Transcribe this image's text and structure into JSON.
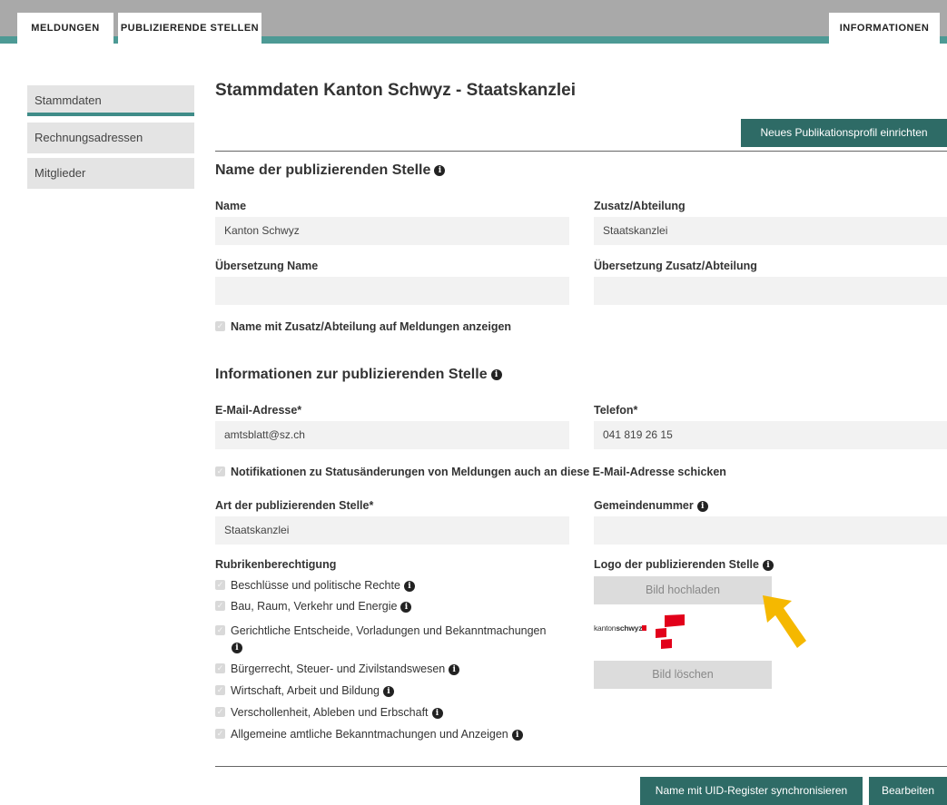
{
  "nav": {
    "tabs": [
      {
        "label": "MELDUNGEN"
      },
      {
        "label": "PUBLIZIERENDE STELLEN"
      },
      {
        "label": "INFORMATIONEN"
      }
    ]
  },
  "sidebar": {
    "items": [
      {
        "label": "Stammdaten"
      },
      {
        "label": "Rechnungsadressen"
      },
      {
        "label": "Mitglieder"
      }
    ]
  },
  "page": {
    "title": "Stammdaten Kanton Schwyz - Staatskanzlei",
    "new_profile_button": "Neues Publikationsprofil einrichten"
  },
  "section_name": {
    "heading": "Name der publizierenden Stelle",
    "name_label": "Name",
    "name_value": "Kanton Schwyz",
    "zusatz_label": "Zusatz/Abteilung",
    "zusatz_value": "Staatskanzlei",
    "translation_name_label": "Übersetzung Name",
    "translation_name_value": "",
    "translation_zusatz_label": "Übersetzung Zusatz/Abteilung",
    "translation_zusatz_value": "",
    "show_zusatz_checkbox": "Name mit Zusatz/Abteilung auf Meldungen anzeigen"
  },
  "section_info": {
    "heading": "Informationen zur publizierenden Stelle",
    "email_label": "E-Mail-Adresse*",
    "email_value": "amtsblatt@sz.ch",
    "phone_label": "Telefon*",
    "phone_value": "041 819 26 15",
    "notify_checkbox": "Notifikationen zu Statusänderungen von Meldungen auch an diese E-Mail-Adresse schicken",
    "type_label": "Art der publizierenden Stelle*",
    "type_value": "Staatskanzlei",
    "municipality_label": "Gemeindenummer",
    "municipality_value": ""
  },
  "rubriken": {
    "label": "Rubrikenberechtigung",
    "items": [
      "Beschlüsse und politische Rechte",
      "Bau, Raum, Verkehr und Energie",
      "Gerichtliche Entscheide, Vorladungen und Bekanntmachungen",
      "Bürgerrecht, Steuer- und Zivilstandswesen",
      "Wirtschaft, Arbeit und Bildung",
      "Verschollenheit, Ableben und Erbschaft",
      "Allgemeine amtliche Bekanntmachungen und Anzeigen"
    ]
  },
  "logo": {
    "label": "Logo der publizierenden Stelle",
    "upload_button": "Bild hochladen",
    "delete_button": "Bild löschen",
    "logo_text_prefix": "kanton",
    "logo_text_bold": "schwyz"
  },
  "footer": {
    "sync_button": "Name mit UID-Register synchronisieren",
    "edit_button": "Bearbeiten"
  },
  "colors": {
    "teal_band": "#4d9a95",
    "dark_button": "#2e6b66",
    "arrow": "#f5b800",
    "logo_red": "#e2001a"
  }
}
